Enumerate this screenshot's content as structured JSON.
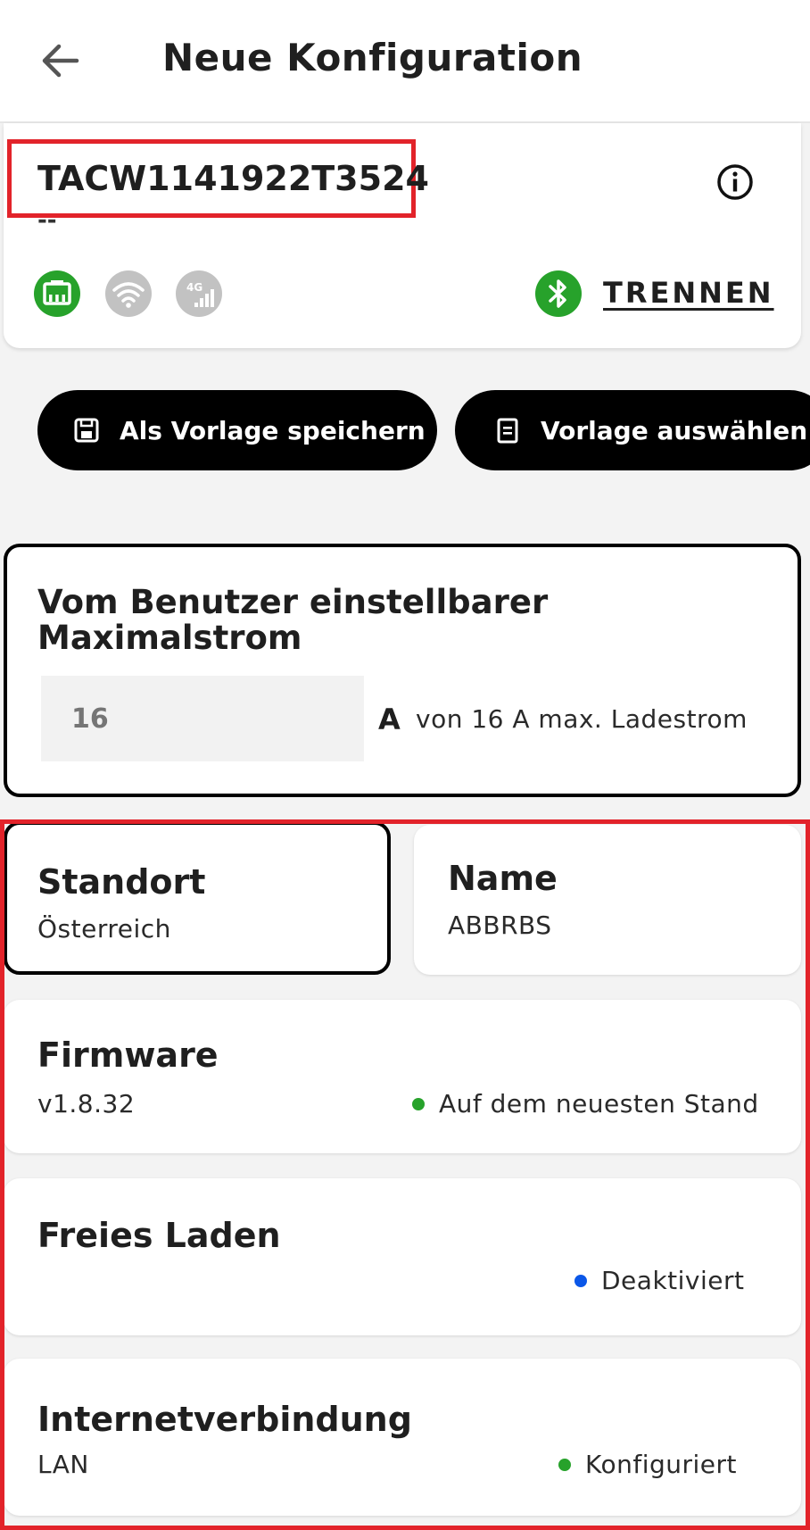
{
  "header": {
    "title": "Neue Konfiguration"
  },
  "device": {
    "id": "TACW1141922T3524",
    "subtitle": "--",
    "disconnect_label": "TRENNEN",
    "connectivity": [
      {
        "icon": "ethernet-icon",
        "active": true
      },
      {
        "icon": "wifi-icon",
        "active": false
      },
      {
        "icon": "4g-icon",
        "active": false
      }
    ],
    "bluetooth_icon": "bluetooth-icon",
    "colors": {
      "active": "#27a22b",
      "inactive": "#c2c2c2"
    }
  },
  "actions": {
    "save_template": "Als Vorlage speichern",
    "select_template": "Vorlage auswählen"
  },
  "current": {
    "title": "Vom Benutzer einstellbarer Maximalstrom",
    "placeholder": "16",
    "unit": "A",
    "hint": "von 16 A max. Ladestrom"
  },
  "location": {
    "title": "Standort",
    "value": "Österreich"
  },
  "name": {
    "title": "Name",
    "value": "ABBRBS"
  },
  "firmware": {
    "title": "Firmware",
    "value": "v1.8.32",
    "status": "Auf dem neuesten Stand",
    "status_color": "#27a22b"
  },
  "free_charging": {
    "title": "Freies Laden",
    "status": "Deaktiviert",
    "status_color": "#0b57e8"
  },
  "internet": {
    "title": "Internetverbindung",
    "value": "LAN",
    "status": "Konfiguriert",
    "status_color": "#27a22b"
  }
}
